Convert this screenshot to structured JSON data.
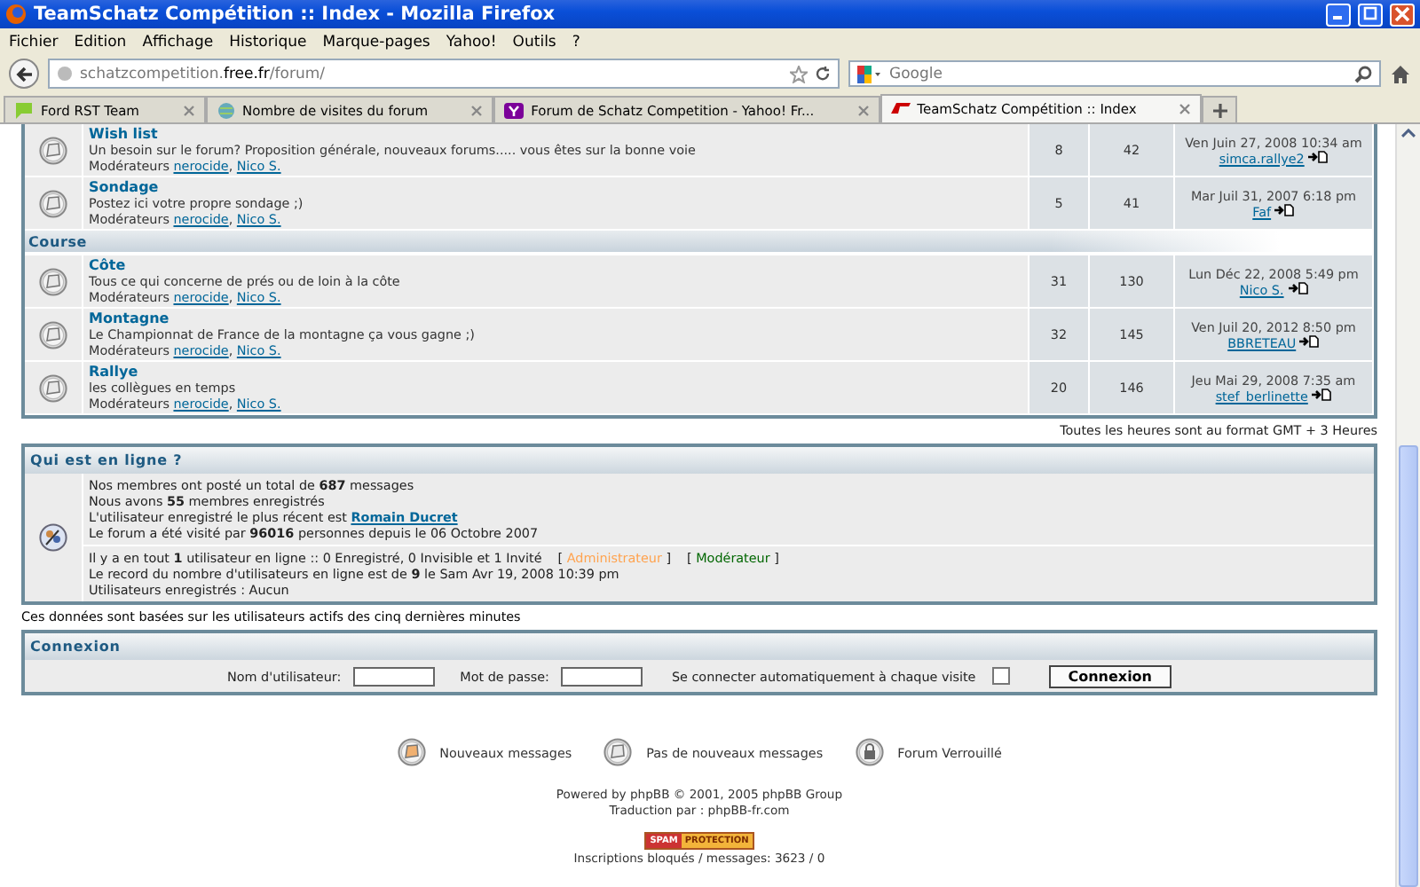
{
  "window": {
    "title": "TeamSchatz Compétition :: Index - Mozilla Firefox"
  },
  "menu": [
    "Fichier",
    "Edition",
    "Affichage",
    "Historique",
    "Marque-pages",
    "Yahoo!",
    "Outils",
    "?"
  ],
  "address": {
    "prefix": "schatzcompetition.",
    "host": "free.fr",
    "path": "/forum/"
  },
  "search": {
    "placeholder": "Google"
  },
  "tabs": [
    {
      "label": "Ford RST Team",
      "kind": "chat",
      "selected": false
    },
    {
      "label": "Nombre de visites du forum",
      "kind": "globe",
      "selected": false
    },
    {
      "label": "Forum de Schatz Competition - Yahoo! Fr...",
      "kind": "yahoo",
      "selected": false
    },
    {
      "label": "TeamSchatz Compétition :: Index",
      "kind": "free",
      "selected": true
    }
  ],
  "moderator_separator": ", ",
  "forums": [
    {
      "kind": "forum",
      "name": "Wish list",
      "description": "Un besoin sur le forum? Proposition générale, nouveaux forums..... vous êtes sur la bonne voie",
      "moderators_label": "Modérateurs",
      "moderators": [
        "nerocide",
        "Nico S."
      ],
      "topics": "8",
      "posts": "42",
      "last_date": "Ven Juin 27, 2008 10:34 am",
      "last_user": "simca.rallye2"
    },
    {
      "kind": "forum",
      "name": "Sondage",
      "description": "Postez ici votre propre sondage ;)",
      "moderators_label": "Modérateurs",
      "moderators": [
        "nerocide",
        "Nico S."
      ],
      "topics": "5",
      "posts": "41",
      "last_date": "Mar Juil 31, 2007 6:18 pm",
      "last_user": "Faf"
    },
    {
      "kind": "category",
      "name": "Course"
    },
    {
      "kind": "forum",
      "name": "Côte",
      "description": "Tous ce qui concerne de prés ou de loin à la côte",
      "moderators_label": "Modérateurs",
      "moderators": [
        "nerocide",
        "Nico S."
      ],
      "topics": "31",
      "posts": "130",
      "last_date": "Lun Déc 22, 2008 5:49 pm",
      "last_user": "Nico S."
    },
    {
      "kind": "forum",
      "name": "Montagne",
      "description": "Le Championnat de France de la montagne ça vous gagne ;)",
      "moderators_label": "Modérateurs",
      "moderators": [
        "nerocide",
        "Nico S."
      ],
      "topics": "32",
      "posts": "145",
      "last_date": "Ven Juil 20, 2012 8:50 pm",
      "last_user": "BBRETEAU"
    },
    {
      "kind": "forum",
      "name": "Rallye",
      "description": "les collègues en temps",
      "moderators_label": "Modérateurs",
      "moderators": [
        "nerocide",
        "Nico S."
      ],
      "topics": "20",
      "posts": "146",
      "last_date": "Jeu Mai 29, 2008 7:35 am",
      "last_user": "stef_berlinette"
    }
  ],
  "timezone": "Toutes les heures sont au format GMT + 3 Heures",
  "online": {
    "title": "Qui est en ligne ?",
    "stats": [
      "Nos membres ont posté un total de **687** messages",
      "Nous avons **55** membres enregistrés"
    ],
    "newest_prefix": "L'utilisateur enregistré le plus récent est",
    "newest_user": "Romain Ducret",
    "visits": "Le forum a été visité par **96016** personnes depuis le 06 Octobre 2007",
    "users_now": "Il y a en tout **1** utilisateur en ligne :: 0 Enregistré, 0 Invisible et 1 Invité",
    "groups": [
      {
        "label": "Administrateur",
        "color": "#ffa34f"
      },
      {
        "label": "Modérateur",
        "color": "#006600"
      }
    ],
    "bracket_open": "[",
    "bracket_close": "]",
    "record": "Le record du nombre d'utilisateurs en ligne est de **9** le Sam Avr 19, 2008 10:39 pm",
    "registered": "Utilisateurs enregistrés : Aucun"
  },
  "online_note": "Ces données sont basées sur les utilisateurs actifs des cinq dernières minutes",
  "login": {
    "title": "Connexion",
    "username_label": "Nom d'utilisateur:",
    "password_label": "Mot de passe:",
    "auto_label": "Se connecter automatiquement à chaque visite",
    "auto_checked": false,
    "button": "Connexion"
  },
  "legend": [
    {
      "kind": "new",
      "label": "Nouveaux messages"
    },
    {
      "kind": "none",
      "label": "Pas de nouveaux messages"
    },
    {
      "kind": "locked",
      "label": "Forum Verrouillé"
    }
  ],
  "footer": {
    "powered": "Powered by phpBB © 2001, 2005 phpBB Group",
    "translation": "Traduction par : phpBB-fr.com",
    "badge_left": "SPAM",
    "badge_right": "PROTECTION",
    "blocked": "Inscriptions bloqués / messages: 3623 / 0"
  }
}
